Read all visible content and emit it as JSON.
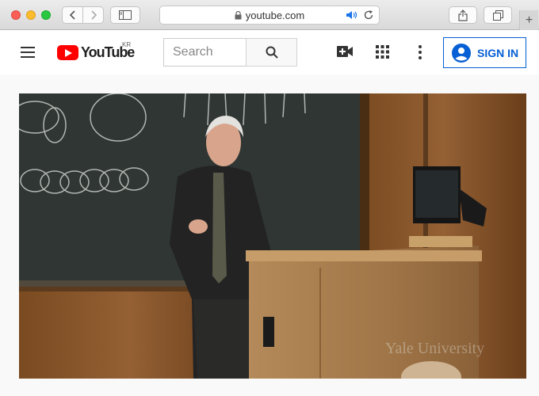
{
  "browser": {
    "url": "youtube.com",
    "icons": [
      "back-icon",
      "forward-icon",
      "sidebar-icon",
      "lock-icon",
      "speaker-icon",
      "reload-icon",
      "share-icon",
      "tabs-icon",
      "plus-icon"
    ],
    "new_tab_glyph": "+"
  },
  "youtube": {
    "logo_text": "YouTube",
    "region": "KR",
    "search_placeholder": "Search",
    "sign_in_label": "SIGN IN",
    "icons": [
      "menu-icon",
      "search-icon",
      "create-video-icon",
      "apps-grid-icon",
      "more-vert-icon",
      "account-icon"
    ]
  },
  "video": {
    "watermark": "Yale University"
  },
  "colors": {
    "accent": "#065fd4",
    "brand_red": "#ff0000"
  }
}
